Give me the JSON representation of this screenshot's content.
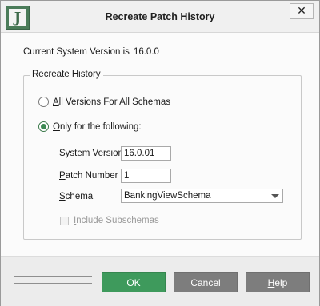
{
  "window": {
    "title": "Recreate Patch History",
    "app_logo_letter": "J",
    "close_glyph": "✕"
  },
  "current_version": {
    "label": "Current System Version is",
    "value": "16.0.0"
  },
  "recreate_history": {
    "legend": "Recreate History",
    "option_all": {
      "label_mnemonic": "A",
      "label_rest": "ll Versions For All Schemas",
      "selected": false
    },
    "option_only": {
      "label_mnemonic": "O",
      "label_rest": "nly for the following:",
      "selected": true
    },
    "system_version": {
      "label_mnemonic": "S",
      "label_rest": "ystem Version",
      "value": "16.0.01"
    },
    "patch_number": {
      "label_mnemonic": "P",
      "label_rest": "atch Number",
      "value": "1"
    },
    "schema": {
      "label_mnemonic": "S",
      "label_rest": "chema",
      "selected_value": "BankingViewSchema"
    },
    "include_subschemas": {
      "label_mnemonic": "I",
      "label_rest": "nclude Subschemas",
      "checked": false,
      "enabled": false
    }
  },
  "buttons": {
    "ok": "OK",
    "cancel": "Cancel",
    "help_mnemonic": "H",
    "help_rest": "elp"
  },
  "colors": {
    "ok_button": "#3e9a5c",
    "secondary_button": "#7d7d7d",
    "logo": "#4b7c59"
  }
}
